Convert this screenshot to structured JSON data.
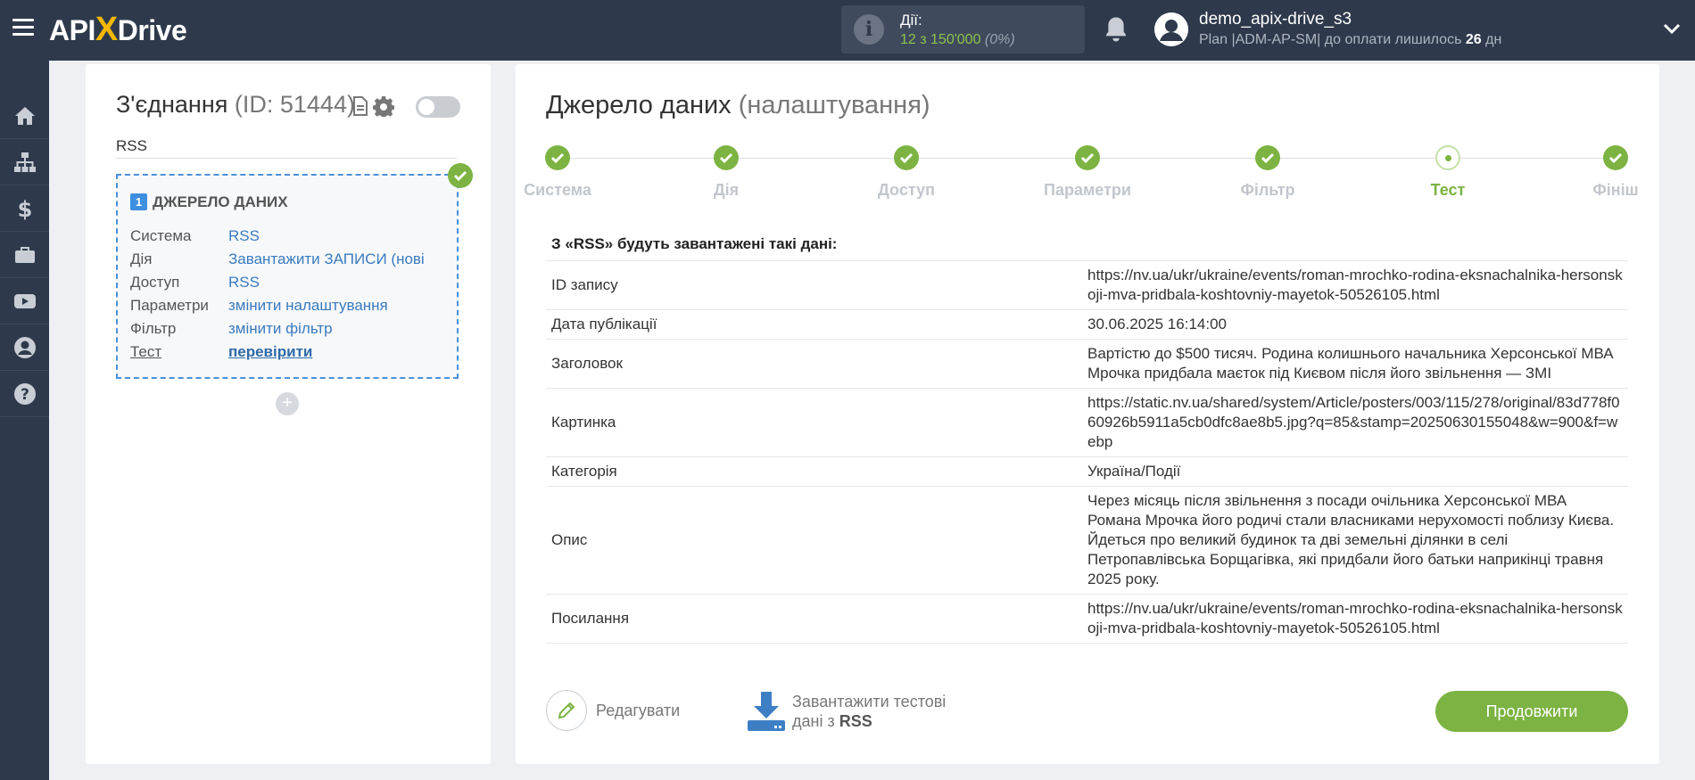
{
  "header": {
    "logo_left": "API",
    "logo_x": "X",
    "logo_right": "Drive",
    "actions_label": "Дії:",
    "actions_value": "12 з 150'000",
    "actions_percent": "(0%)",
    "user_name": "demo_apix-drive_s3",
    "user_plan": "Plan |ADM-AP-SM| до оплати лишилось",
    "days_left": "26",
    "days_unit": "дн"
  },
  "sidebar": {
    "items": [
      "home-icon",
      "sitemap-icon",
      "dollar-icon",
      "briefcase-icon",
      "youtube-icon",
      "user-icon",
      "help-icon"
    ]
  },
  "connection": {
    "title": "З'єднання",
    "id_text": "(ID: 51444)",
    "name": "RSS",
    "source_number": "1",
    "source_header": "ДЖЕРЕЛО ДАНИХ",
    "rows": [
      {
        "key": "Система",
        "value": "RSS"
      },
      {
        "key": "Дія",
        "value": "Завантажити ЗАПИСИ (нові"
      },
      {
        "key": "Доступ",
        "value": "RSS"
      },
      {
        "key": "Параметри",
        "value": "змінити налаштування"
      },
      {
        "key": "Фільтр",
        "value": "змінити фільтр"
      },
      {
        "key": "Тест",
        "value": "перевірити"
      }
    ],
    "add_label": "+"
  },
  "source": {
    "title": "Джерело даних",
    "subtitle": "(налаштування)",
    "steps": [
      "Система",
      "Дія",
      "Доступ",
      "Параметри",
      "Фільтр",
      "Тест",
      "Фініш"
    ],
    "current_step": "Тест",
    "data_title": "З «RSS» будуть завантажені такі дані:",
    "rows": [
      {
        "key": "ID запису",
        "value": "https://nv.ua/ukr/ukraine/events/roman-mrochko-rodina-eksnachalnika-hersonskoji-mva-pridbala-koshtovniy-mayetok-50526105.html"
      },
      {
        "key": "Дата публікації",
        "value": "30.06.2025 16:14:00"
      },
      {
        "key": "Заголовок",
        "value": "Вартістю до $500 тисяч. Родина колишнього начальника Херсонської МВА Мрочка придбала маєток під Києвом після його звільнення — ЗМІ"
      },
      {
        "key": "Картинка",
        "value": "https://static.nv.ua/shared/system/Article/posters/003/115/278/original/83d778f060926b5911a5cb0dfc8ae8b5.jpg?q=85&stamp=20250630155048&w=900&f=webp"
      },
      {
        "key": "Категорія",
        "value": "Україна/Події"
      },
      {
        "key": "Опис",
        "value": "Через місяць після звільнення з посади очільника Херсонської МВА Романа Мрочка його родичі стали власниками нерухомості поблизу Києва. Йдеться про великий будинок та дві земельні ділянки в селі Петропавлівська Борщагівка, які придбали його батьки наприкінці травня 2025 року."
      },
      {
        "key": "Посилання",
        "value": "https://nv.ua/ukr/ukraine/events/roman-mrochko-rodina-eksnachalnika-hersonskoji-mva-pridbala-koshtovniy-mayetok-50526105.html"
      }
    ],
    "edit_label": "Редагувати",
    "download_label_1": "Завантажити тестові",
    "download_label_2": "дані з",
    "download_source": "RSS",
    "continue_label": "Продовжити"
  },
  "colors": {
    "topbar": "#2e3a4c",
    "accent_green": "#7cb342",
    "link_blue": "#3a7bbf",
    "dashed_border": "#4a90d9"
  }
}
